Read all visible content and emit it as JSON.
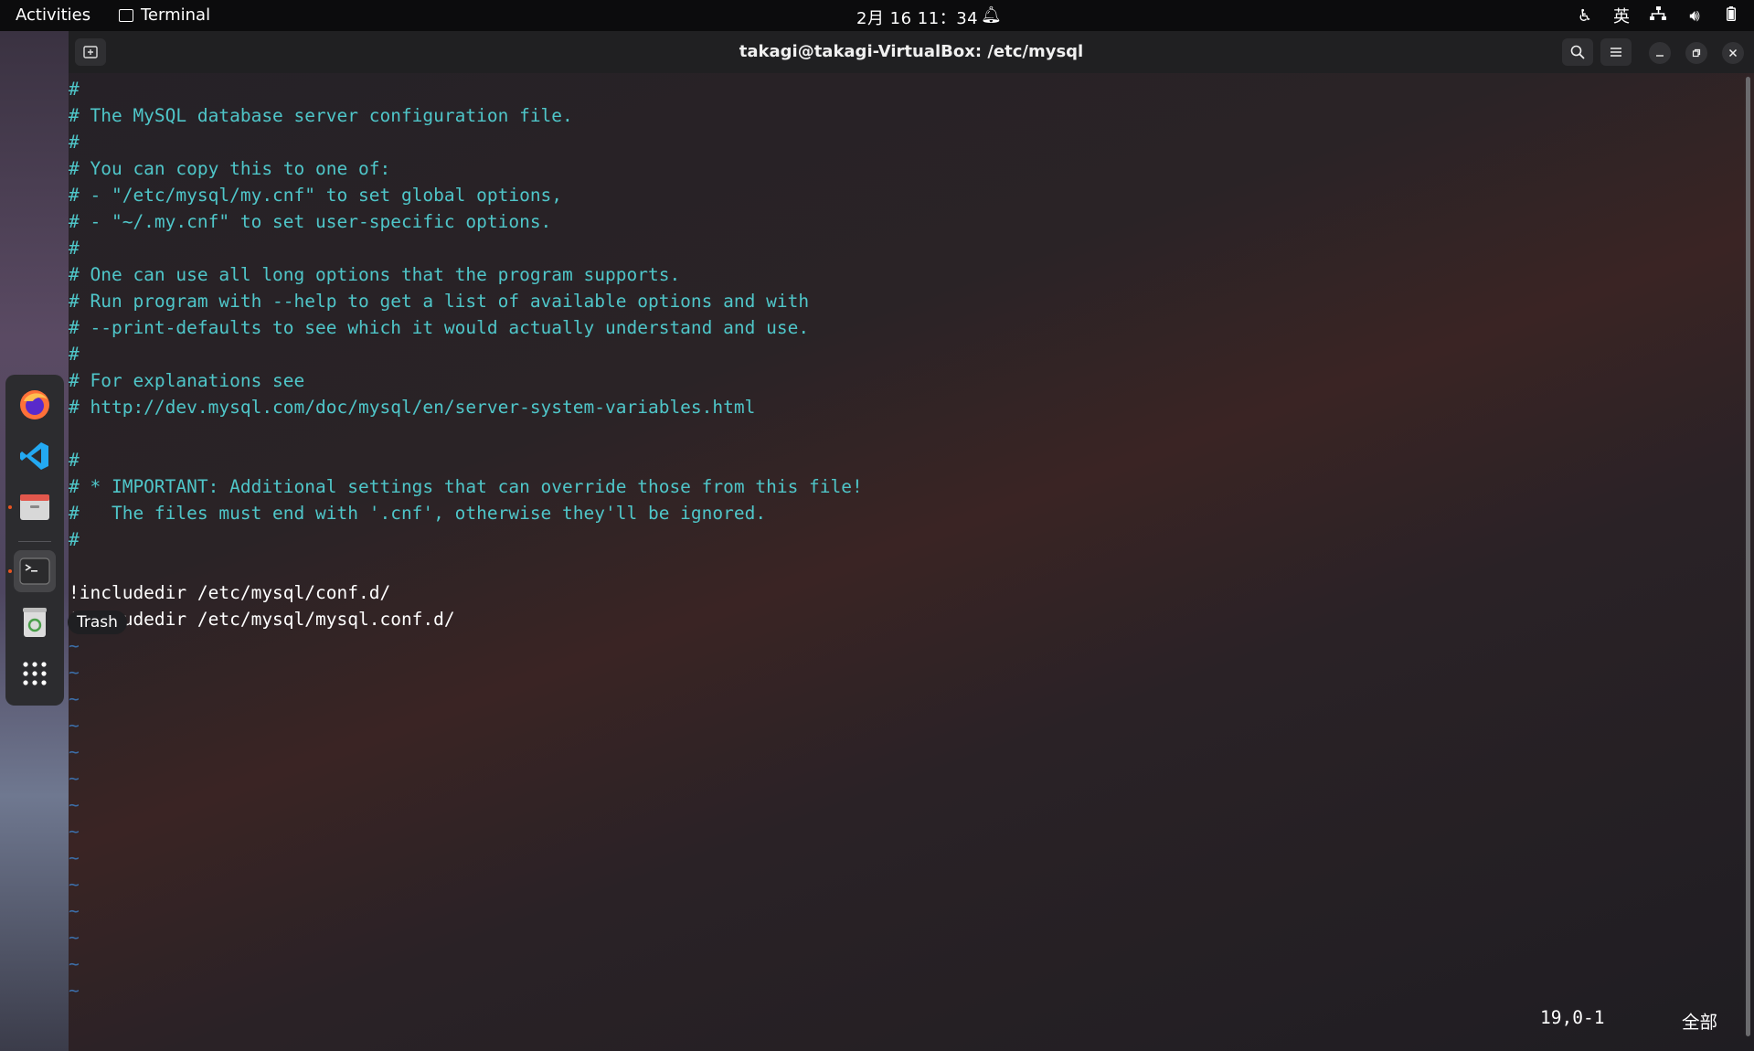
{
  "topbar": {
    "activities": "Activities",
    "app_name": "Terminal",
    "clock": "2月 16  11：34",
    "input_method": "英"
  },
  "dock": {
    "tooltip": "Trash",
    "items": [
      "firefox-icon",
      "vscode-icon",
      "files-icon",
      "terminal-icon",
      "trash-icon",
      "show-apps-icon"
    ]
  },
  "window": {
    "title": "takagi@takagi-VirtualBox: /etc/mysql"
  },
  "editor": {
    "lines": [
      {
        "text": "#",
        "type": "comment"
      },
      {
        "text": "# The MySQL database server configuration file.",
        "type": "comment"
      },
      {
        "text": "#",
        "type": "comment"
      },
      {
        "text": "# You can copy this to one of:",
        "type": "comment"
      },
      {
        "text": "# - \"/etc/mysql/my.cnf\" to set global options,",
        "type": "comment"
      },
      {
        "text": "# - \"~/.my.cnf\" to set user-specific options.",
        "type": "comment"
      },
      {
        "text": "#",
        "type": "comment"
      },
      {
        "text": "# One can use all long options that the program supports.",
        "type": "comment"
      },
      {
        "text": "# Run program with --help to get a list of available options and with",
        "type": "comment"
      },
      {
        "text": "# --print-defaults to see which it would actually understand and use.",
        "type": "comment"
      },
      {
        "text": "#",
        "type": "comment"
      },
      {
        "text": "# For explanations see",
        "type": "comment"
      },
      {
        "text": "# http://dev.mysql.com/doc/mysql/en/server-system-variables.html",
        "type": "comment"
      },
      {
        "text": "",
        "type": "plain"
      },
      {
        "text": "#",
        "type": "comment"
      },
      {
        "text": "# * IMPORTANT: Additional settings that can override those from this file!",
        "type": "comment"
      },
      {
        "text": "#   The files must end with '.cnf', otherwise they'll be ignored.",
        "type": "comment"
      },
      {
        "text": "#",
        "type": "comment"
      },
      {
        "text": "",
        "type": "plain"
      },
      {
        "text": "!includedir /etc/mysql/conf.d/",
        "type": "plain"
      },
      {
        "text": "!includedir /etc/mysql/mysql.conf.d/",
        "type": "plain"
      },
      {
        "text": "~",
        "type": "tilde"
      },
      {
        "text": "~",
        "type": "tilde"
      },
      {
        "text": "~",
        "type": "tilde"
      },
      {
        "text": "~",
        "type": "tilde"
      },
      {
        "text": "~",
        "type": "tilde"
      },
      {
        "text": "~",
        "type": "tilde"
      },
      {
        "text": "~",
        "type": "tilde"
      },
      {
        "text": "~",
        "type": "tilde"
      },
      {
        "text": "~",
        "type": "tilde"
      },
      {
        "text": "~",
        "type": "tilde"
      },
      {
        "text": "~",
        "type": "tilde"
      },
      {
        "text": "~",
        "type": "tilde"
      },
      {
        "text": "~",
        "type": "tilde"
      },
      {
        "text": "~",
        "type": "tilde"
      }
    ],
    "status_position": "19,0-1",
    "status_scroll": "全部"
  },
  "colors": {
    "comment": "#4fc6c9",
    "tilde": "#3c6ea8",
    "accent": "#e95420"
  }
}
